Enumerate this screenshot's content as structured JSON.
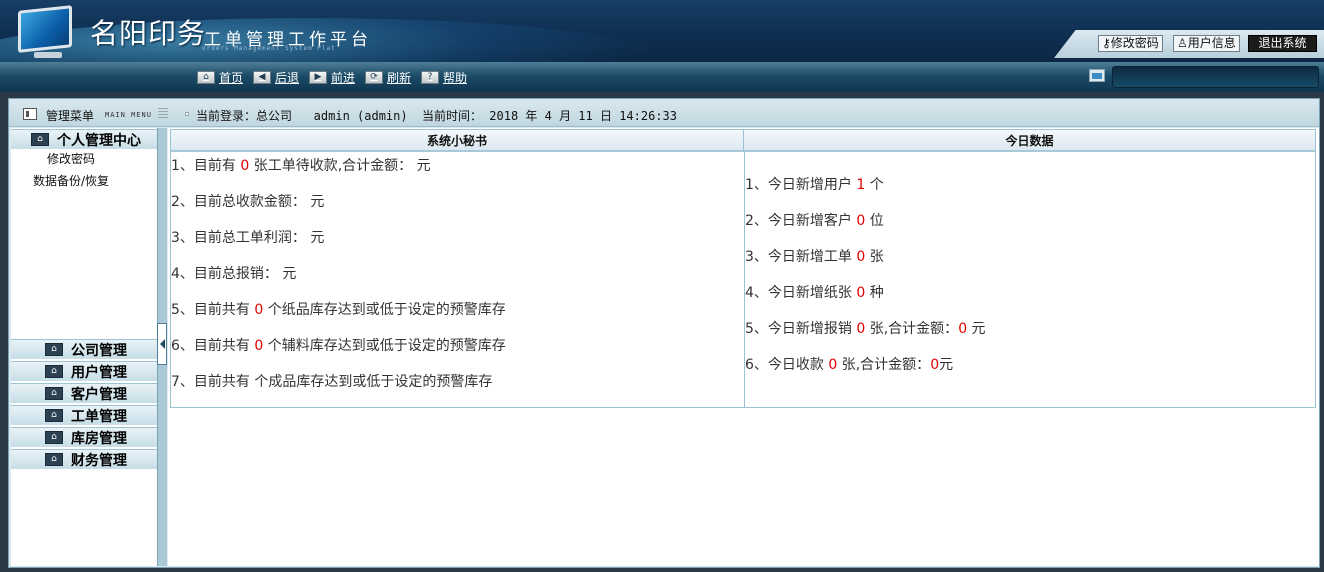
{
  "header": {
    "brand_title": "名阳印务",
    "brand_subtitle": "工单管理工作平台",
    "brand_en": "orders Management System Plat",
    "change_password": "修改密码",
    "user_info": "用户信息",
    "logout": "退出系统"
  },
  "nav": {
    "home": "首页",
    "back": "后退",
    "forward": "前进",
    "refresh": "刷新",
    "help": "帮助"
  },
  "topbar": {
    "menu_title": "管理菜单",
    "menu_title_en": "MAIN MENU",
    "login_info": "当前登录：总公司   admin (admin)  当前时间： 2018 年 4 月 11 日 14:26:33"
  },
  "sidebar": {
    "personal": "个人管理中心",
    "personal_items": [
      "修改密码",
      "数据备份/恢复"
    ],
    "company": "公司管理",
    "user": "用户管理",
    "customer": "客户管理",
    "order": "工单管理",
    "warehouse": "库房管理",
    "finance": "财务管理"
  },
  "left_panel": {
    "title": "系统小秘书",
    "rows": [
      {
        "pre": "1、目前有 ",
        "num": "0",
        "post": " 张工单待收款,合计金额：  元"
      },
      {
        "pre": "2、目前总收款金额：  元",
        "num": "",
        "post": ""
      },
      {
        "pre": "3、目前总工单利润：  元",
        "num": "",
        "post": ""
      },
      {
        "pre": "4、目前总报销：  元",
        "num": "",
        "post": ""
      },
      {
        "pre": "5、目前共有 ",
        "num": "0",
        "post": " 个纸品库存达到或低于设定的预警库存"
      },
      {
        "pre": "6、目前共有 ",
        "num": "0",
        "post": " 个辅料库存达到或低于设定的预警库存"
      },
      {
        "pre": "7、目前共有  个成品库存达到或低于设定的预警库存",
        "num": "",
        "post": ""
      }
    ]
  },
  "right_panel": {
    "title": "今日数据",
    "rows": [
      {
        "pre": "1、今日新增用户 ",
        "num": "1",
        "post": " 个",
        "num2": "",
        "post2": ""
      },
      {
        "pre": "2、今日新增客户 ",
        "num": "0",
        "post": " 位",
        "num2": "",
        "post2": ""
      },
      {
        "pre": "3、今日新增工单 ",
        "num": "0",
        "post": " 张",
        "num2": "",
        "post2": ""
      },
      {
        "pre": "4、今日新增纸张 ",
        "num": "0",
        "post": " 种",
        "num2": "",
        "post2": ""
      },
      {
        "pre": "5、今日新增报销 ",
        "num": "0",
        "post": " 张,合计金额：",
        "num2": "0",
        "post2": " 元"
      },
      {
        "pre": "6、今日收款 ",
        "num": "0",
        "post": " 张,合计金额：",
        "num2": "0",
        "post2": "元"
      }
    ]
  }
}
